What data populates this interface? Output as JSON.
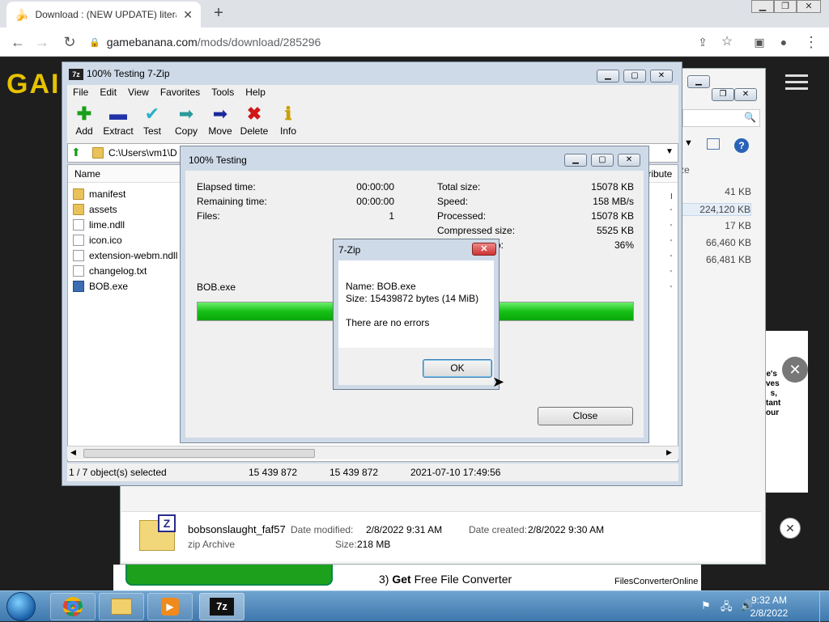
{
  "browser": {
    "tab_title": "Download : (NEW UPDATE) litera",
    "new_tab": "+",
    "url_domain": "gamebanana.com",
    "url_path": "/mods/download/285296",
    "site_logo": "GAI"
  },
  "explorer": {
    "sizes": [
      "41 KB",
      "224,120 KB",
      "17 KB",
      "66,460 KB",
      "66,481 KB"
    ],
    "size_header": "ze",
    "file": {
      "name": "bobsonslaught_faf57",
      "type": "zip Archive",
      "modified_label": "Date modified:",
      "modified": "2/8/2022 9:31 AM",
      "created_label": "Date created:",
      "created": "2/8/2022 9:30 AM",
      "size_label": "Size:",
      "size": "218 MB"
    }
  },
  "zip": {
    "title": "100% Testing 7-Zip",
    "menu": [
      "File",
      "Edit",
      "View",
      "Favorites",
      "Tools",
      "Help"
    ],
    "toolbar": [
      "Add",
      "Extract",
      "Test",
      "Copy",
      "Move",
      "Delete",
      "Info"
    ],
    "path": "C:\\Users\\vm1\\D",
    "col_name": "Name",
    "col_attr": "tribute",
    "files": [
      {
        "name": "manifest",
        "kind": "folder"
      },
      {
        "name": "assets",
        "kind": "folder"
      },
      {
        "name": "lime.ndll",
        "kind": "doc"
      },
      {
        "name": "icon.ico",
        "kind": "doc"
      },
      {
        "name": "extension-webm.ndll",
        "kind": "doc"
      },
      {
        "name": "changelog.txt",
        "kind": "doc"
      },
      {
        "name": "BOB.exe",
        "kind": "exe"
      }
    ],
    "status": {
      "selected": "1 / 7 object(s) selected",
      "size": "15 439 872",
      "packed": "15 439 872",
      "date": "2021-07-10 17:49:56"
    }
  },
  "testing": {
    "title": "100% Testing",
    "elapsed_label": "Elapsed time:",
    "elapsed": "00:00:00",
    "remaining_label": "Remaining time:",
    "remaining": "00:00:00",
    "files_label": "Files:",
    "files": "1",
    "total_label": "Total size:",
    "total": "15078 KB",
    "speed_label": "Speed:",
    "speed": "158 MB/s",
    "processed_label": "Processed:",
    "processed": "15078 KB",
    "compressed_label": "Compressed size:",
    "compressed": "5525 KB",
    "ratio_label": "p:",
    "ratio": "36%",
    "current_file": "BOB.exe",
    "progress": 1.0,
    "close": "Close"
  },
  "msgbox": {
    "title": "7-Zip",
    "name_line": "Name: BOB.exe",
    "size_line": "Size: 15439872 bytes (14 MiB)",
    "result": "There are no errors",
    "ok": "OK"
  },
  "ad": {
    "step": "3)",
    "get": "Get",
    "rest": "Free File Converter",
    "brand": "FilesConverterOnline",
    "side_lines": [
      "e's",
      "ves",
      "s,",
      "tant",
      "our"
    ]
  },
  "taskbar": {
    "time": "9:32 AM",
    "date": "2/8/2022",
    "zip_label": "7z"
  }
}
